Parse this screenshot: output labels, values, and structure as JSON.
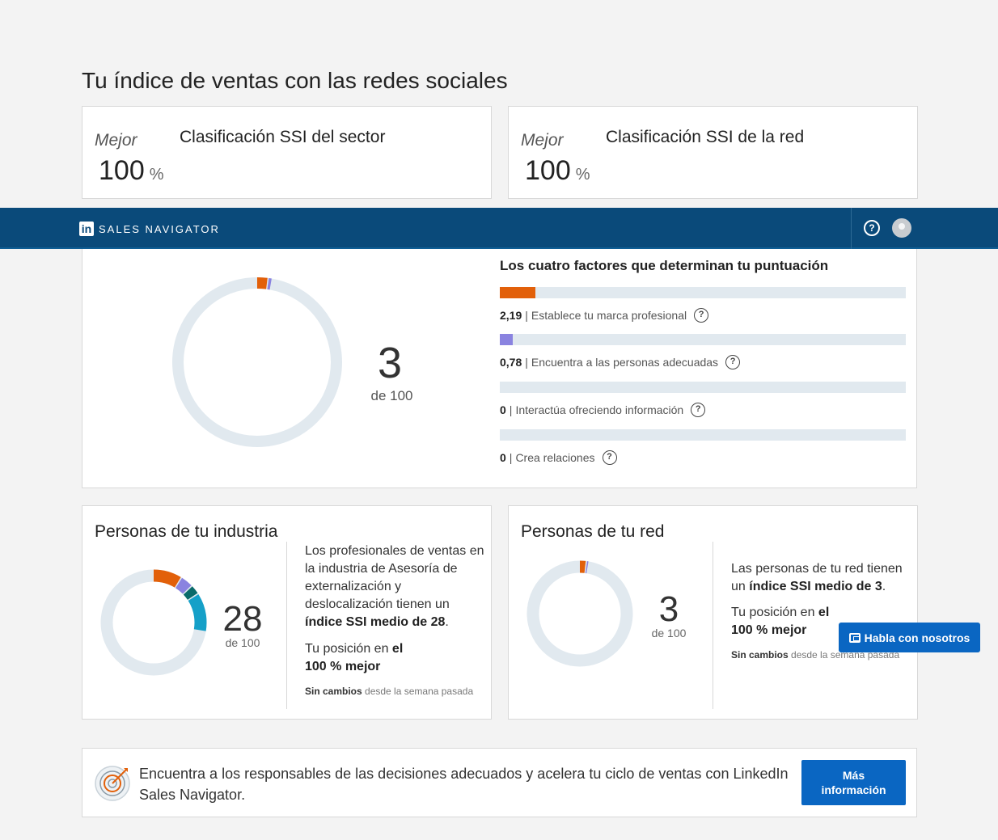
{
  "page": {
    "title": "Tu índice de ventas con las redes sociales"
  },
  "rank_cards": [
    {
      "best_label": "Mejor",
      "title": "Clasificación SSI del sector",
      "value": "100",
      "unit": "%"
    },
    {
      "best_label": "Mejor",
      "title": "Clasificación SSI de la red",
      "value": "100",
      "unit": "%"
    }
  ],
  "navbar": {
    "logo": "in",
    "brand": "SALES NAVIGATOR",
    "help_icon": "question-circle-icon",
    "avatar_icon": "user-avatar-icon"
  },
  "score": {
    "value": "3",
    "denominator": "de 100",
    "value_number": 3,
    "max": 100,
    "factors_title": "Los cuatro factores que determinan tu puntuación",
    "factors": [
      {
        "value": "2,19",
        "label": "Establece tu marca profesional",
        "score": 2.19,
        "max": 25,
        "color": "#e2600a"
      },
      {
        "value": "0,78",
        "label": "Encuentra a las personas adecuadas",
        "score": 0.78,
        "max": 25,
        "color": "#8a83e0"
      },
      {
        "value": "0",
        "label": "Interactúa ofreciendo información",
        "score": 0,
        "max": 25,
        "color": "#15a0c8"
      },
      {
        "value": "0",
        "label": "Crea relaciones",
        "score": 0,
        "max": 25,
        "color": "#0a6a6a"
      }
    ]
  },
  "industry": {
    "heading": "Personas de tu industria",
    "value": "28",
    "denominator": "de 100",
    "desc_1": "Los profesionales de ventas en la industria de Asesoría de externalización y deslocalización tienen un",
    "desc_bold": "índice SSI medio de 28",
    "desc_end": ".",
    "pos_prefix": "Tu posición en",
    "pos_bold_1": "el",
    "pos_bold_2": "100 % mejor",
    "change_bold": "Sin cambios",
    "change_rest": "desde la semana pasada",
    "segments": [
      {
        "value": 9,
        "color": "#e2600a"
      },
      {
        "value": 4,
        "color": "#8a83e0"
      },
      {
        "value": 3,
        "color": "#0a6a6a"
      },
      {
        "value": 12,
        "color": "#15a0c8"
      }
    ]
  },
  "network": {
    "heading": "Personas de tu red",
    "value": "3",
    "denominator": "de 100",
    "desc_1": "Las personas de tu red tienen un",
    "desc_bold": "índice SSI medio de 3",
    "desc_end": ".",
    "pos_prefix": "Tu posición en",
    "pos_bold_1": "el",
    "pos_bold_2": "100 % mejor",
    "change_bold": "Sin cambios",
    "change_rest": "desde la semana pasada",
    "segments": [
      {
        "value": 2.2,
        "color": "#e2600a"
      },
      {
        "value": 0.8,
        "color": "#8a83e0"
      }
    ]
  },
  "chat": {
    "label": "Habla con nosotros",
    "icon": "chat-bubble-icon"
  },
  "promo": {
    "icon": "target-icon",
    "text": "Encuentra a los responsables de las decisiones adecuados y acelera tu ciclo de ventas con LinkedIn Sales Navigator.",
    "button_line1": "Más",
    "button_line2": "información"
  }
}
